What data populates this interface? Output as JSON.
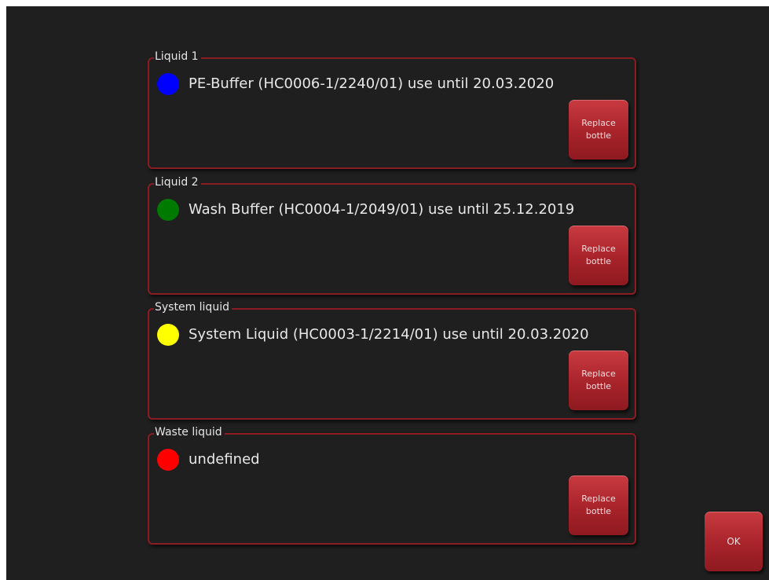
{
  "liquids": [
    {
      "legend": "Liquid 1",
      "description": "PE-Buffer (HC0006-1/2240/01) use until 20.03.2020",
      "color": "#0000ff",
      "button_line1": "Replace",
      "button_line2": "bottle"
    },
    {
      "legend": "Liquid 2",
      "description": "Wash Buffer (HC0004-1/2049/01) use until 25.12.2019",
      "color": "#007a00",
      "button_line1": "Replace",
      "button_line2": "bottle"
    },
    {
      "legend": "System liquid",
      "description": "System Liquid (HC0003-1/2214/01) use until 20.03.2020",
      "color": "#ffff00",
      "button_line1": "Replace",
      "button_line2": "bottle"
    },
    {
      "legend": "Waste liquid",
      "description": "undefined",
      "color": "#ff0000",
      "button_line1": "Replace",
      "button_line2": "bottle"
    }
  ],
  "ok_label": "OK",
  "colors": {
    "background": "#1f1f1f",
    "frame_border": "#8a1c22",
    "button": "#a8232a"
  }
}
